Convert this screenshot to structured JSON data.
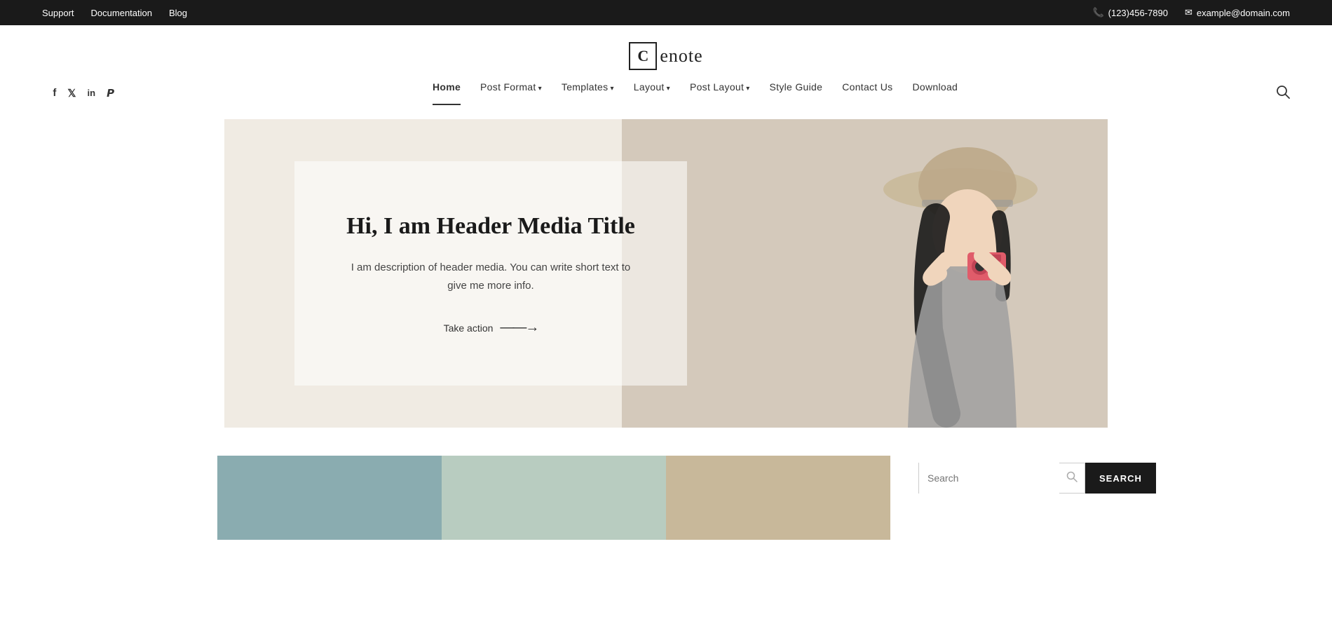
{
  "topbar": {
    "links": [
      "Support",
      "Documentation",
      "Blog"
    ],
    "phone": "(123)456-7890",
    "email": "example@domain.com"
  },
  "logo": {
    "letter": "C",
    "name": "enote"
  },
  "social": {
    "icons": [
      "f",
      "t",
      "in",
      "p"
    ]
  },
  "nav": {
    "items": [
      {
        "label": "Home",
        "active": true,
        "hasDropdown": false
      },
      {
        "label": "Post Format",
        "active": false,
        "hasDropdown": true
      },
      {
        "label": "Templates",
        "active": false,
        "hasDropdown": true
      },
      {
        "label": "Layout",
        "active": false,
        "hasDropdown": true
      },
      {
        "label": "Post Layout",
        "active": false,
        "hasDropdown": true
      },
      {
        "label": "Style Guide",
        "active": false,
        "hasDropdown": false
      },
      {
        "label": "Contact Us",
        "active": false,
        "hasDropdown": false
      },
      {
        "label": "Download",
        "active": false,
        "hasDropdown": false
      }
    ]
  },
  "hero": {
    "title": "Hi, I am Header Media Title",
    "description": "I am description of header media. You can write short text to give me more info.",
    "cta_label": "Take action",
    "cta_arrow": "——→"
  },
  "search": {
    "placeholder": "Search",
    "button_label": "SEARCH"
  }
}
